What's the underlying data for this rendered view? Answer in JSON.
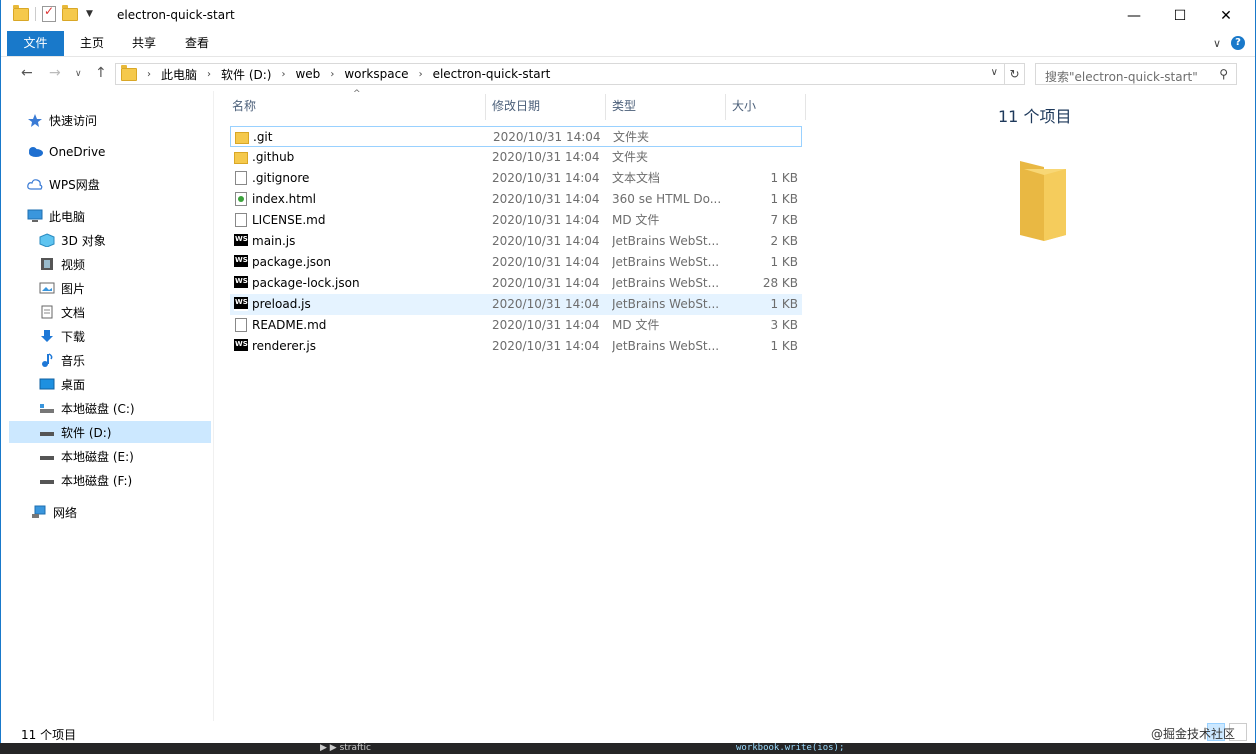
{
  "titlebar": {
    "title": "electron-quick-start",
    "minimize": "—",
    "maximize": "☐",
    "close": "✕"
  },
  "ribbon": {
    "tabs": [
      "文件",
      "主页",
      "共享",
      "查看"
    ],
    "expand": "∨",
    "help": "?"
  },
  "address": {
    "back": "←",
    "forward": "→",
    "recent": "∨",
    "up": "↑",
    "crumbs": [
      "此电脑",
      "软件 (D:)",
      "web",
      "workspace",
      "electron-quick-start"
    ],
    "search_placeholder": "搜索\"electron-quick-start\""
  },
  "nav": {
    "items": [
      {
        "label": "快速访问",
        "icon": "star-icon"
      },
      {
        "label": "OneDrive",
        "icon": "cloud-icon"
      },
      {
        "label": "WPS网盘",
        "icon": "cloud-outline-icon"
      },
      {
        "label": "此电脑",
        "icon": "computer-icon"
      },
      {
        "label": "3D 对象",
        "icon": "cube-icon"
      },
      {
        "label": "视频",
        "icon": "video-icon"
      },
      {
        "label": "图片",
        "icon": "picture-icon"
      },
      {
        "label": "文档",
        "icon": "document-icon"
      },
      {
        "label": "下载",
        "icon": "download-icon"
      },
      {
        "label": "音乐",
        "icon": "music-icon"
      },
      {
        "label": "桌面",
        "icon": "desktop-icon"
      },
      {
        "label": "本地磁盘 (C:)",
        "icon": "drive-icon"
      },
      {
        "label": "软件 (D:)",
        "icon": "drive-icon"
      },
      {
        "label": "本地磁盘 (E:)",
        "icon": "drive-icon"
      },
      {
        "label": "本地磁盘 (F:)",
        "icon": "drive-icon"
      },
      {
        "label": "网络",
        "icon": "network-icon"
      }
    ],
    "selected": "软件 (D:)"
  },
  "columns": {
    "name": "名称",
    "modified": "修改日期",
    "type": "类型",
    "size": "大小"
  },
  "files": [
    {
      "name": ".git",
      "modified": "2020/10/31 14:04",
      "type": "文件夹",
      "size": "",
      "icon": "folder-icon"
    },
    {
      "name": ".github",
      "modified": "2020/10/31 14:04",
      "type": "文件夹",
      "size": "",
      "icon": "folder-icon"
    },
    {
      "name": ".gitignore",
      "modified": "2020/10/31 14:04",
      "type": "文本文档",
      "size": "1 KB",
      "icon": "text-file-icon"
    },
    {
      "name": "index.html",
      "modified": "2020/10/31 14:04",
      "type": "360 se HTML Do...",
      "size": "1 KB",
      "icon": "html-file-icon"
    },
    {
      "name": "LICENSE.md",
      "modified": "2020/10/31 14:04",
      "type": "MD 文件",
      "size": "7 KB",
      "icon": "file-icon"
    },
    {
      "name": "main.js",
      "modified": "2020/10/31 14:04",
      "type": "JetBrains WebSt...",
      "size": "2 KB",
      "icon": "webstorm-icon"
    },
    {
      "name": "package.json",
      "modified": "2020/10/31 14:04",
      "type": "JetBrains WebSt...",
      "size": "1 KB",
      "icon": "webstorm-icon"
    },
    {
      "name": "package-lock.json",
      "modified": "2020/10/31 14:04",
      "type": "JetBrains WebSt...",
      "size": "28 KB",
      "icon": "webstorm-icon"
    },
    {
      "name": "preload.js",
      "modified": "2020/10/31 14:04",
      "type": "JetBrains WebSt...",
      "size": "1 KB",
      "icon": "webstorm-icon"
    },
    {
      "name": "README.md",
      "modified": "2020/10/31 14:04",
      "type": "MD 文件",
      "size": "3 KB",
      "icon": "file-icon"
    },
    {
      "name": "renderer.js",
      "modified": "2020/10/31 14:04",
      "type": "JetBrains WebSt...",
      "size": "1 KB",
      "icon": "webstorm-icon"
    }
  ],
  "details": {
    "title": "11 个项目"
  },
  "status": {
    "count": "11 个项目"
  },
  "watermark": "@掘金技术社区",
  "background": {
    "code": "workbook.write(ios);",
    "tree": "▶ ▶ straftic"
  }
}
